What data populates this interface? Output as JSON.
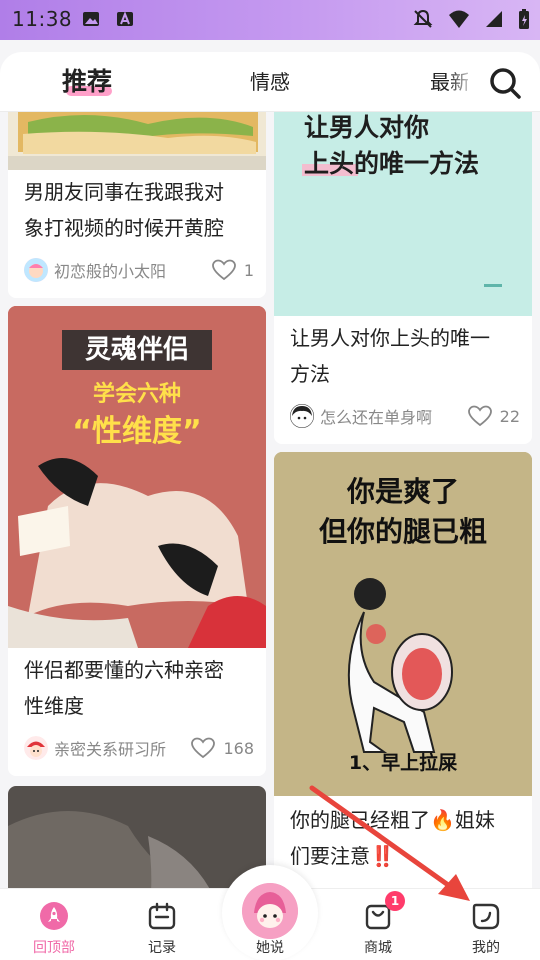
{
  "status_bar": {
    "time": "11:38"
  },
  "header": {
    "tabs": [
      {
        "label": "推荐"
      },
      {
        "label": "情感"
      },
      {
        "label": "最新"
      }
    ]
  },
  "feed": {
    "cards": [
      {
        "title_lines": [
          "男朋友同事在我跟我对",
          "象打视频的时候开黄腔"
        ],
        "author": "初恋般的小太阳",
        "likes": "1"
      },
      {
        "image_text_lines": [
          "让男人对你",
          "上头的唯一方法"
        ],
        "title_lines": [
          "让男人对你上头的唯一",
          "方法"
        ],
        "author": "怎么还在单身啊",
        "likes": "22"
      },
      {
        "image_text_lines": [
          "灵魂伴侣",
          "学会六种",
          "“性维度”"
        ],
        "title_lines": [
          "伴侣都要懂的六种亲密",
          "性维度"
        ],
        "author": "亲密关系研习所",
        "likes": "168"
      },
      {
        "image_text_lines": [
          "你是爽了",
          "但你的腿已粗",
          "1、早上拉屎"
        ],
        "title_lines": [
          "你的腿已经粗了🔥姐妹",
          "们要注意‼️"
        ]
      },
      {
        "title_lines": []
      }
    ]
  },
  "bottom_nav": {
    "items": [
      {
        "label": "回顶部"
      },
      {
        "label": "记录"
      },
      {
        "label": "她说"
      },
      {
        "label": "商城",
        "badge": "1"
      },
      {
        "label": "我的"
      }
    ]
  },
  "colors": {
    "accent": "#f06aa8",
    "status_bar": "#b07ee8",
    "arrow": "#e8453c"
  }
}
